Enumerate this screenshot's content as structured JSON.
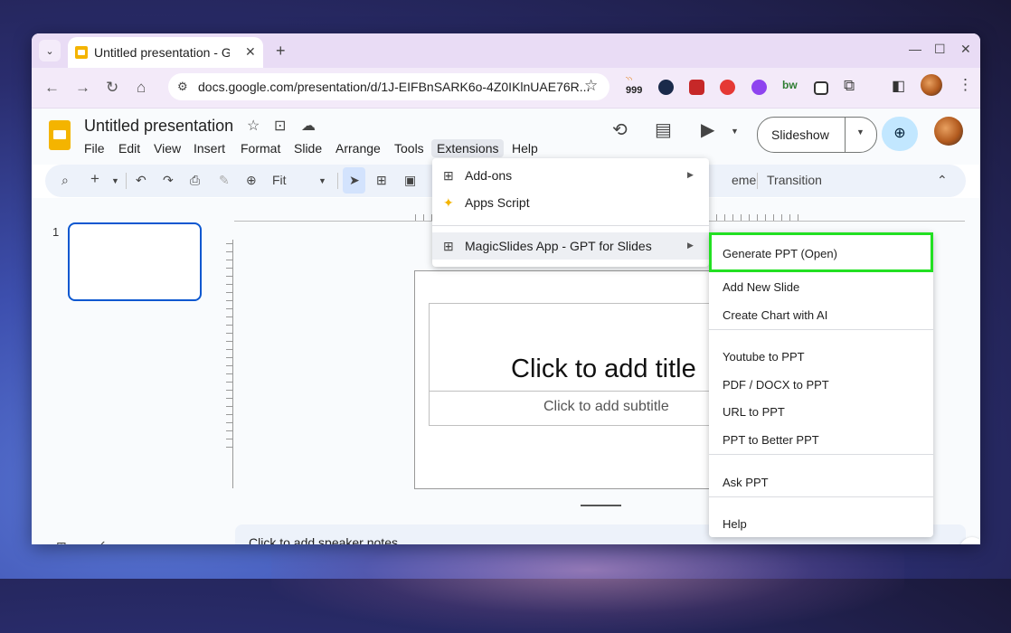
{
  "browser": {
    "tab_search_glyph": "⌄",
    "tab_title": "Untitled presentation - Google Slides",
    "tab_close": "✕",
    "new_tab": "+",
    "win_min": "—",
    "win_max": "☐",
    "win_close": "✕",
    "back": "←",
    "forward": "→",
    "reload": "↻",
    "home": "⌂",
    "url": "docs.google.com/presentation/d/1J-EIFBnSARK6o-4Z0IKlnUAE76R...",
    "ext_badge": "999",
    "menu_dots": "⋮"
  },
  "docs": {
    "title": "Untitled presentation",
    "menu": [
      "File",
      "Edit",
      "View",
      "Insert",
      "Format",
      "Slide",
      "Arrange",
      "Tools",
      "Extensions",
      "Help"
    ],
    "active_menu": "Extensions",
    "slideshow_label": "Slideshow"
  },
  "toolbar": {
    "zoom_label": "Fit",
    "right_tabs": [
      "eme",
      "Transition"
    ]
  },
  "slide": {
    "number": "1",
    "title_placeholder": "Click to add title",
    "subtitle_placeholder": "Click to add subtitle",
    "notes_placeholder": "Click to add speaker notes"
  },
  "extensions_menu": {
    "items": [
      {
        "label": "Add-ons",
        "icon": "add-ons-icon"
      },
      {
        "label": "Apps Script",
        "icon": "apps-script-icon"
      },
      {
        "label": "MagicSlides App - GPT for Slides",
        "icon": "add-on-app-icon"
      }
    ]
  },
  "magicslides_submenu": {
    "items": [
      "Generate PPT (Open)",
      "Add New Slide",
      "Create Chart with AI",
      "Youtube to PPT",
      "PDF / DOCX to PPT",
      "URL to PPT",
      "PPT to Better PPT",
      "Ask PPT",
      "Help"
    ],
    "highlight_color": "#22e022"
  }
}
